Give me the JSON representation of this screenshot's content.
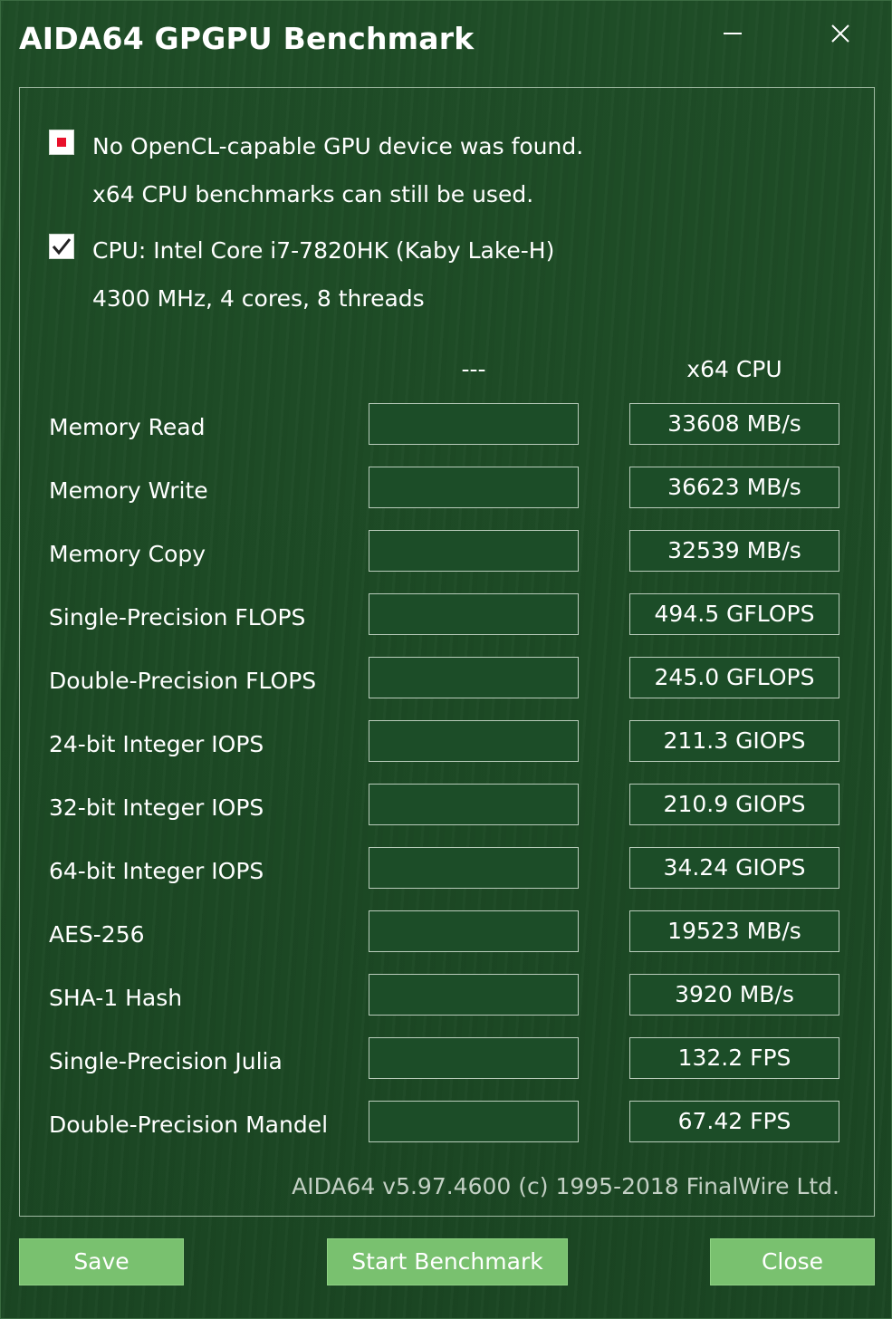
{
  "window": {
    "title": "AIDA64 GPGPU Benchmark"
  },
  "icons": {
    "minimize": "minimize-icon",
    "close": "close-icon",
    "error": "error-indicator-icon",
    "check": "checkmark-icon"
  },
  "status": {
    "gpu_line1": "No OpenCL-capable GPU device was found.",
    "gpu_line2": "x64 CPU benchmarks can still be used.",
    "cpu_line1": "CPU: Intel Core i7-7820HK  (Kaby Lake-H)",
    "cpu_line2": "4300 MHz, 4 cores, 8 threads"
  },
  "columns": {
    "gpu": "---",
    "cpu": "x64 CPU"
  },
  "benchmarks": [
    {
      "label": "Memory Read",
      "gpu": "",
      "cpu": "33608 MB/s"
    },
    {
      "label": "Memory Write",
      "gpu": "",
      "cpu": "36623 MB/s"
    },
    {
      "label": "Memory Copy",
      "gpu": "",
      "cpu": "32539 MB/s"
    },
    {
      "label": "Single-Precision FLOPS",
      "gpu": "",
      "cpu": "494.5 GFLOPS"
    },
    {
      "label": "Double-Precision FLOPS",
      "gpu": "",
      "cpu": "245.0 GFLOPS"
    },
    {
      "label": "24-bit Integer IOPS",
      "gpu": "",
      "cpu": "211.3 GIOPS"
    },
    {
      "label": "32-bit Integer IOPS",
      "gpu": "",
      "cpu": "210.9 GIOPS"
    },
    {
      "label": "64-bit Integer IOPS",
      "gpu": "",
      "cpu": "34.24 GIOPS"
    },
    {
      "label": "AES-256",
      "gpu": "",
      "cpu": "19523 MB/s"
    },
    {
      "label": "SHA-1 Hash",
      "gpu": "",
      "cpu": "3920 MB/s"
    },
    {
      "label": "Single-Precision Julia",
      "gpu": "",
      "cpu": "132.2 FPS"
    },
    {
      "label": "Double-Precision Mandel",
      "gpu": "",
      "cpu": "67.42 FPS"
    }
  ],
  "footer": {
    "version": "AIDA64 v5.97.4600  (c) 1995-2018 FinalWire Ltd."
  },
  "buttons": {
    "save": "Save",
    "start": "Start Benchmark",
    "close": "Close"
  },
  "colors": {
    "background": "#1d4a25",
    "button": "#79c16f",
    "error_red": "#e8102a"
  }
}
